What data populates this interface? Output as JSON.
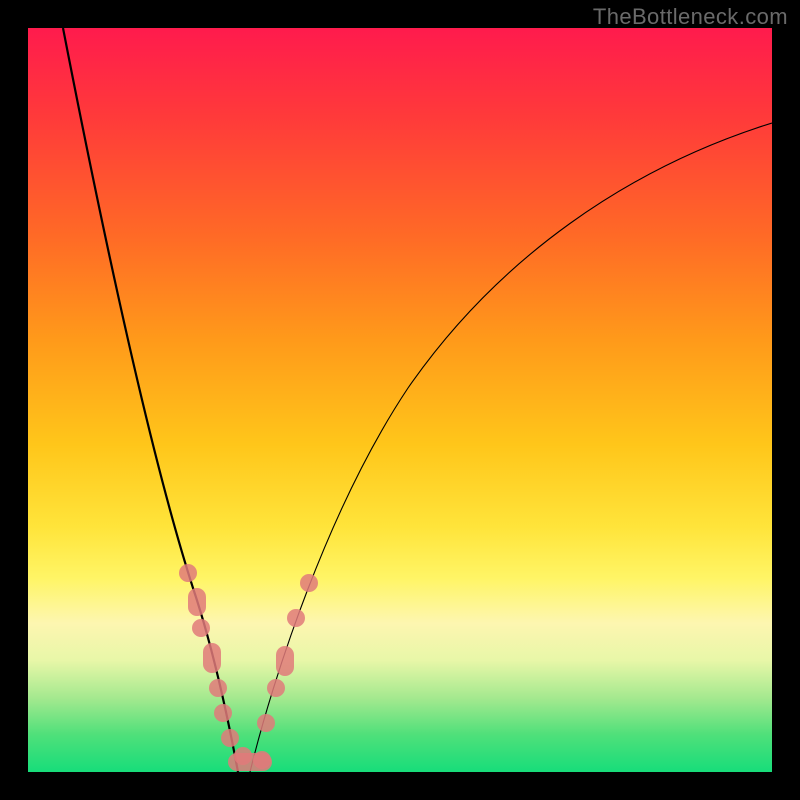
{
  "watermark": "TheBottleneck.com",
  "colors": {
    "gradient_top": "#ff1b4d",
    "gradient_bottom": "#17dd7a",
    "curve": "#000000",
    "markers": "#e07a7a",
    "border": "#000000"
  },
  "chart_data": {
    "type": "line",
    "title": "",
    "xlabel": "",
    "ylabel": "",
    "xlim": [
      0,
      100
    ],
    "ylim": [
      0,
      100
    ],
    "legend": false,
    "grid": false,
    "series": [
      {
        "name": "left-branch",
        "x": [
          5,
          8,
          11,
          14,
          17,
          19,
          21,
          22.5,
          24,
          25.5,
          27
        ],
        "y": [
          100,
          82,
          66,
          52,
          40,
          31,
          23,
          16,
          10,
          4,
          0
        ]
      },
      {
        "name": "right-branch",
        "x": [
          29,
          32,
          36,
          41,
          47,
          55,
          65,
          78,
          90,
          100
        ],
        "y": [
          0,
          10,
          23,
          37,
          50,
          61,
          71,
          79,
          84,
          87
        ]
      }
    ],
    "markers_left": [
      {
        "x": 20.5,
        "y": 27
      },
      {
        "x": 21.8,
        "y": 22
      },
      {
        "x": 22.5,
        "y": 19
      },
      {
        "x": 24.0,
        "y": 12
      },
      {
        "x": 25.0,
        "y": 8
      },
      {
        "x": 25.8,
        "y": 5
      },
      {
        "x": 26.5,
        "y": 2.5
      }
    ],
    "markers_right": [
      {
        "x": 31.0,
        "y": 7
      },
      {
        "x": 32.5,
        "y": 12
      },
      {
        "x": 33.5,
        "y": 16
      },
      {
        "x": 35.5,
        "y": 22
      },
      {
        "x": 37.0,
        "y": 26
      }
    ],
    "trough_cluster": {
      "x0": 27,
      "x1": 31,
      "y": 0.8
    }
  }
}
